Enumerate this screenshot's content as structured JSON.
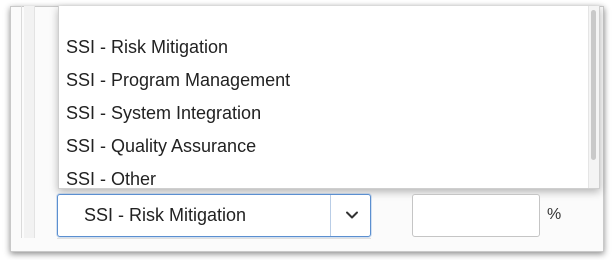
{
  "dropdown": {
    "options": [
      "SSI - Risk Mitigation",
      "SSI - Program Management",
      "SSI - System Integration",
      "SSI - Quality Assurance",
      "SSI - Other"
    ]
  },
  "select": {
    "value": "SSI - Risk Mitigation",
    "icon": "chevron-down-icon"
  },
  "percent": {
    "value": "",
    "suffix": "%"
  }
}
